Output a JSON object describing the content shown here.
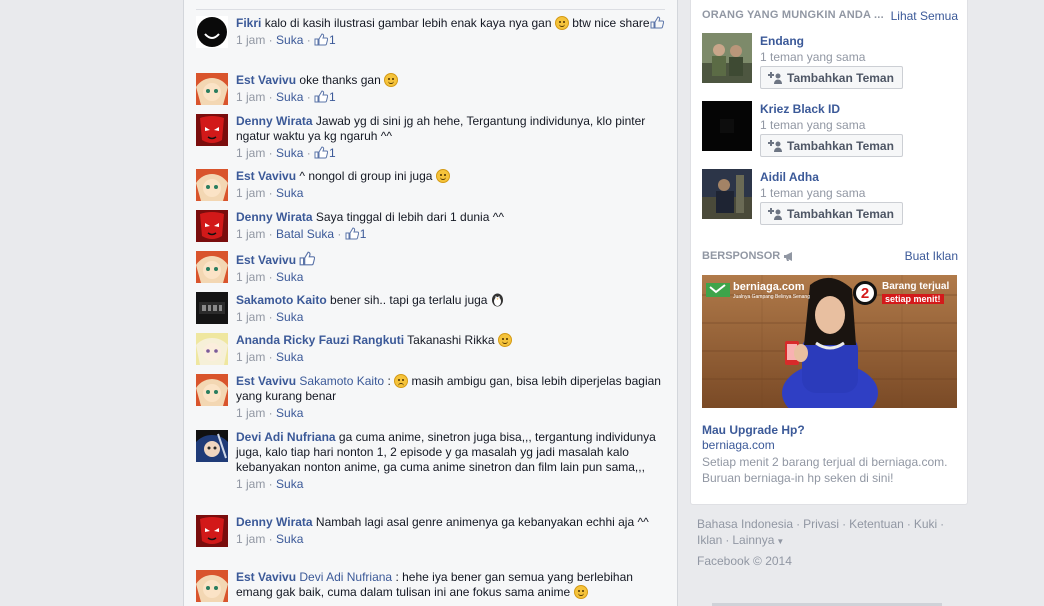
{
  "colors": {
    "link": "#3b5998",
    "meta": "#9197a3",
    "background": "#e9eaed"
  },
  "comments": [
    {
      "author": "Fikri",
      "text": "kalo di kasih ilustrasi gambar lebih enak kaya nya gan",
      "text2": "btw nice share",
      "time": "1 jam",
      "action": "Suka",
      "likes": "1",
      "avatar": "black-circle-smile"
    },
    {
      "author": "Est Vavivu",
      "text": "oke thanks gan",
      "time": "1 jam",
      "action": "Suka",
      "likes": "1",
      "avatar": "anime-girl"
    },
    {
      "author": "Denny Wirata",
      "text": "Jawab yg di sini jg ah hehe, Tergantung individunya, klo pinter ngatur waktu ya kg ngaruh ^^",
      "time": "1 jam",
      "action": "Suka",
      "likes": "1",
      "avatar": "red-mask"
    },
    {
      "author": "Est Vavivu",
      "text": "^ nongol di group ini juga",
      "time": "1 jam",
      "action": "Suka",
      "avatar": "anime-girl"
    },
    {
      "author": "Denny Wirata",
      "text": "Saya tinggal di lebih dari 1 dunia ^^",
      "time": "1 jam",
      "action": "Batal Suka",
      "likes": "1",
      "avatar": "red-mask"
    },
    {
      "author": "Est Vavivu",
      "time": "1 jam",
      "action": "Suka",
      "avatar": "anime-girl"
    },
    {
      "author": "Sakamoto Kaito",
      "text": "bener sih.. tapi ga terlalu juga",
      "time": "1 jam",
      "action": "Suka",
      "avatar": "dark-logo"
    },
    {
      "author": "Ananda Ricky Fauzi Rangkuti",
      "text": "Takanashi Rikka",
      "time": "1 jam",
      "action": "Suka",
      "avatar": "anime-light"
    },
    {
      "author": "Est Vavivu",
      "mention": "Sakamoto Kaito",
      "text": ": ",
      "text2": "masih ambigu gan, bisa lebih diperjelas bagian yang kurang benar",
      "time": "1 jam",
      "action": "Suka",
      "avatar": "anime-girl"
    },
    {
      "author": "Devi Adi Nufriana",
      "text": "ga cuma anime, sinetron juga bisa,,, tergantung individunya juga, kalo tiap hari nonton 1, 2 episode y ga masalah yg jadi masalah kalo kebanyakan nonton anime, ga cuma anime sinetron dan film lain pun sama,,,",
      "time": "1 jam",
      "action": "Suka",
      "avatar": "anime-blue"
    },
    {
      "author": "Denny Wirata",
      "text": "Nambah lagi asal genre animenya ga kebanyakan echhi aja ^^",
      "time": "1 jam",
      "action": "Suka",
      "avatar": "red-mask"
    },
    {
      "author": "Est Vavivu",
      "mention": "Devi Adi Nufriana",
      "text": ": hehe iya bener gan semua yang berlebihan emang gak baik, cuma dalam tulisan ini ane fokus sama anime",
      "avatar": "anime-girl"
    }
  ],
  "sidebar": {
    "pymk_title": "ORANG YANG MUNGKIN ANDA ...",
    "see_all": "Lihat Semua",
    "people": [
      {
        "name": "Endang",
        "mutual": "1 teman yang sama",
        "button": "Tambahkan Teman"
      },
      {
        "name": "Kriez Black ID",
        "mutual": "1 teman yang sama",
        "button": "Tambahkan Teman"
      },
      {
        "name": "Aidil Adha",
        "mutual": "1 teman yang sama",
        "button": "Tambahkan Teman"
      }
    ],
    "sponsored_title": "BERSPONSOR",
    "create_ad": "Buat Iklan",
    "ad": {
      "brand": "berniaga.com",
      "tagline": "Jualnya Gampang Belinya Senang",
      "badge_number": "2",
      "badge_line1": "Barang terjual",
      "badge_line2": "setiap menit!",
      "title": "Mau Upgrade Hp?",
      "domain": "berniaga.com",
      "text": "Setiap menit 2 barang terjual di berniaga.com. Buruan berniaga-in hp seken di sini!"
    }
  },
  "footer": {
    "links": [
      "Bahasa Indonesia",
      "Privasi",
      "Ketentuan",
      "Kuki",
      "Iklan",
      "Lainnya"
    ],
    "copyright": "Facebook © 2014"
  }
}
